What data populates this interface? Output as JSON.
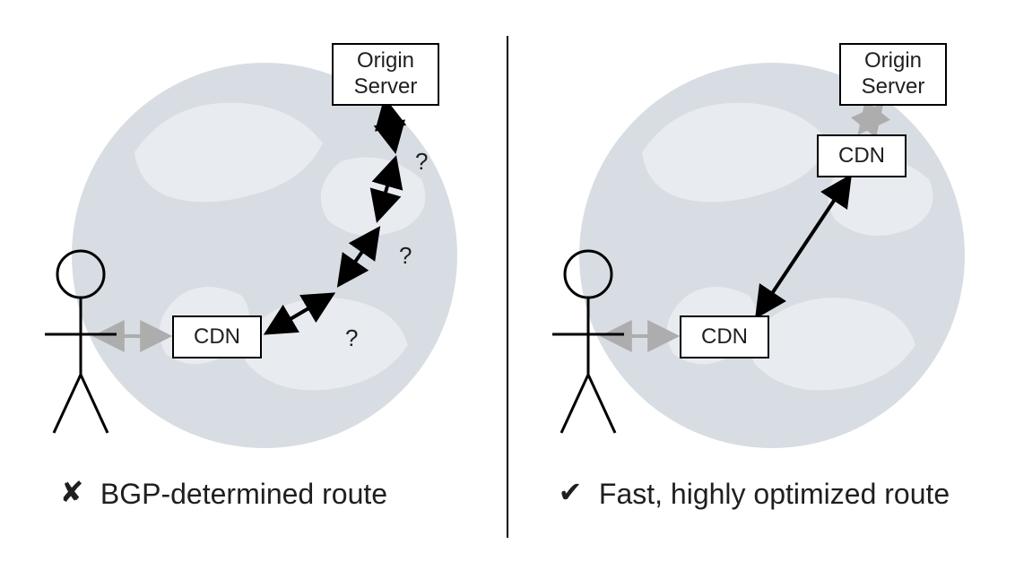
{
  "left": {
    "caption_icon": "✘",
    "caption_text": "BGP-determined route",
    "origin_box": "Origin\nServer",
    "cdn_box": "CDN",
    "q1": "?",
    "q2": "?",
    "q3": "?"
  },
  "right": {
    "caption_icon": "✔",
    "caption_text": "Fast, highly optimized route",
    "origin_box": "Origin\nServer",
    "cdn_top_box": "CDN",
    "cdn_bottom_box": "CDN"
  },
  "colors": {
    "globe_fill": "#d8dde3",
    "globe_land": "#e8ebef",
    "arrow_dark": "#000000",
    "arrow_light": "#adadad"
  }
}
